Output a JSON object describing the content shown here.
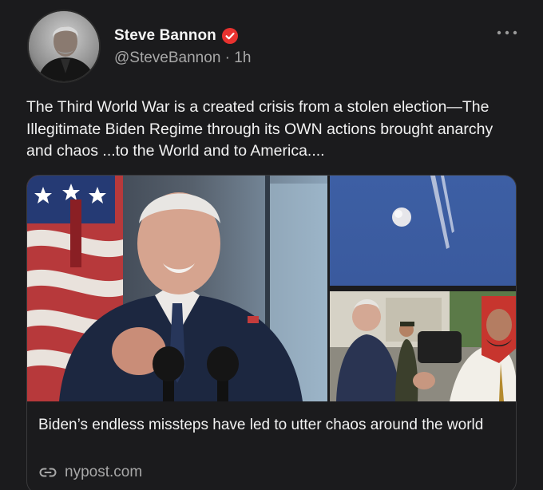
{
  "author": {
    "display_name": "Steve Bannon",
    "handle": "@SteveBannon",
    "separator": "·",
    "time_ago": "1h",
    "badge_color": "#e8322f",
    "avatar_icon": "profile-photo"
  },
  "post": {
    "text": "The Third World War is a created crisis from a stolen election—The Illegitimate Biden Regime through its OWN actions brought anarchy and chaos ...to the World and to America...."
  },
  "link_card": {
    "title": "Biden’s endless missteps have led to utter chaos around the world",
    "source": "nypost.com",
    "source_icon": "link-icon",
    "images": [
      "photo-biden-podium",
      "photo-balloon-sky",
      "photo-fistbump"
    ]
  },
  "more_icon": "more-options-icon",
  "colors": {
    "background": "#1b1b1d",
    "text": "#f2f2f2",
    "muted": "#a8a8a8",
    "card_border": "#3a3a3c"
  }
}
